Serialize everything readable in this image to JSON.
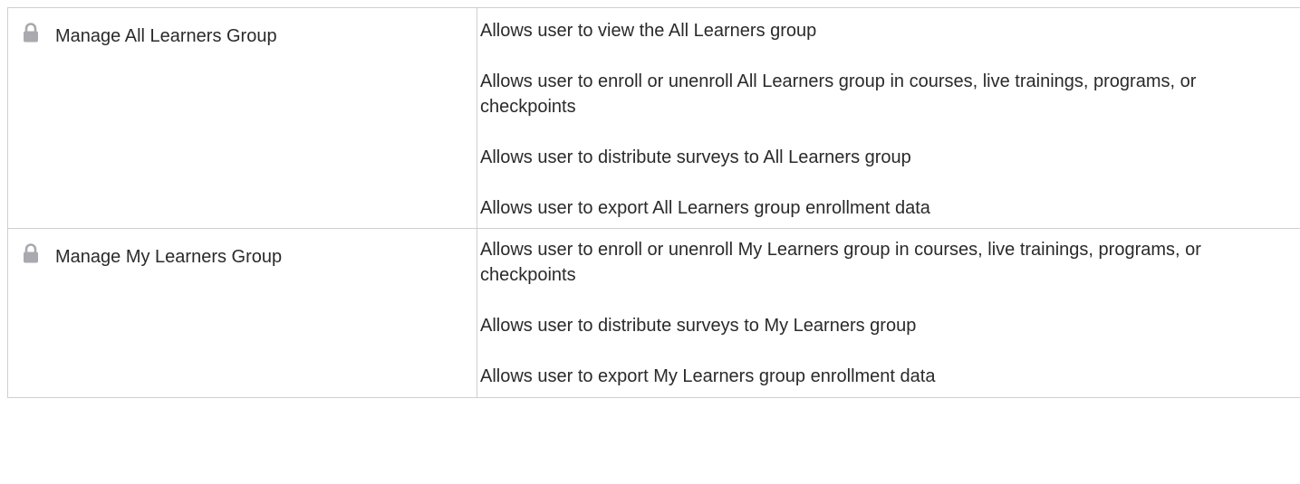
{
  "rows": [
    {
      "name": "Manage All Learners Group",
      "icon": "lock-icon",
      "permissions": [
        "Allows user to view the All Learners group",
        "Allows user to enroll or unenroll All Learners group in courses, live trainings, programs, or checkpoints",
        "Allows user to distribute surveys to All Learners group",
        "Allows user to export All Learners group enrollment data"
      ]
    },
    {
      "name": "Manage My Learners Group",
      "icon": "lock-icon",
      "permissions": [
        "Allows user to enroll or unenroll My Learners group in courses, live trainings, programs, or checkpoints",
        "Allows user to distribute surveys to My Learners group",
        "Allows user to export My Learners group enrollment data"
      ]
    }
  ],
  "colors": {
    "border": "#cfcfcf",
    "text": "#2a2a2a",
    "lock": "#a9a9ae"
  }
}
